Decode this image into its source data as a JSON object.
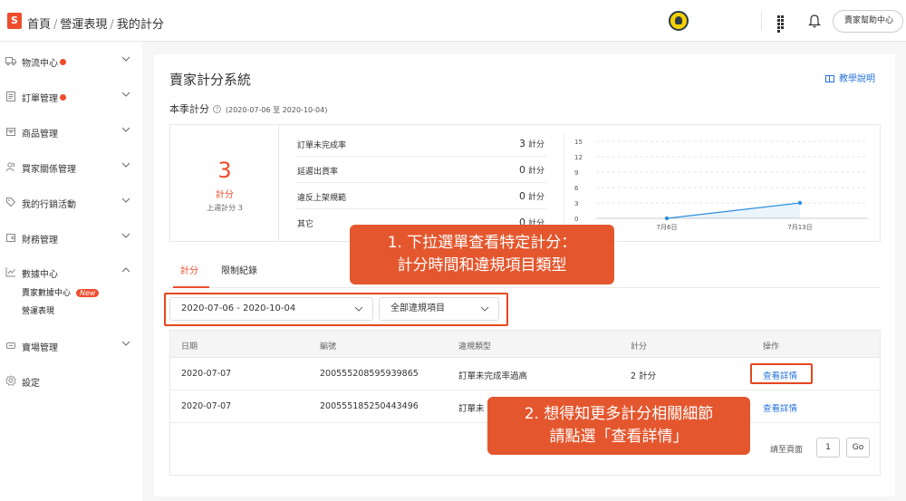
{
  "header": {
    "logo_letter": "S",
    "breadcrumb": [
      "首頁",
      "營運表現",
      "我的計分"
    ],
    "breadcrumb_sep": "/",
    "help_button": "賣家幫助中心"
  },
  "sidebar": {
    "items": [
      {
        "label": "物流中心",
        "icon": "truck-icon",
        "dot": true
      },
      {
        "label": "訂單管理",
        "icon": "clipboard-icon",
        "dot": true
      },
      {
        "label": "商品管理",
        "icon": "box-icon",
        "dot": false
      },
      {
        "label": "買家關係管理",
        "icon": "people-icon",
        "dot": false
      },
      {
        "label": "我的行銷活動",
        "icon": "tag-icon",
        "dot": false
      },
      {
        "label": "財務管理",
        "icon": "wallet-icon",
        "dot": false
      },
      {
        "label": "數據中心",
        "icon": "chart-icon",
        "dot": false,
        "expanded": true
      },
      {
        "label": "賣場管理",
        "icon": "shop-icon",
        "dot": false
      },
      {
        "label": "設定",
        "icon": "gear-icon",
        "dot": false
      }
    ],
    "subitems": [
      {
        "label": "賣家數據中心",
        "badge": "New"
      },
      {
        "label": "營運表現",
        "badge": ""
      }
    ]
  },
  "page": {
    "title": "賣家計分系統",
    "tutorial": "教學說明",
    "season_label": "本季計分",
    "season_help": "?",
    "season_range": "(2020-07-06 至 2020-10-04)"
  },
  "score": {
    "total": "3",
    "unit": "計分",
    "previous": "上週計分 3",
    "breakdown": [
      {
        "label": "訂單未完成率",
        "value": "3",
        "unit": "計分"
      },
      {
        "label": "延遲出貨率",
        "value": "0",
        "unit": "計分"
      },
      {
        "label": "違反上架規範",
        "value": "0",
        "unit": "計分"
      },
      {
        "label": "其它",
        "value": "0",
        "unit": "計分"
      }
    ]
  },
  "chart_data": {
    "type": "line",
    "x": [
      "7月6日",
      "7月13日"
    ],
    "series": [
      {
        "values": [
          0,
          3
        ]
      }
    ],
    "y_ticks": [
      "15",
      "12",
      "9",
      "6",
      "3",
      "0"
    ],
    "ylim": [
      0,
      15
    ],
    "grid": true,
    "line_color": "#2f8fde"
  },
  "tabs": [
    {
      "label": "計分",
      "active": true
    },
    {
      "label": "限制紀錄",
      "active": false
    }
  ],
  "filters": {
    "date_range": "2020-07-06 - 2020-10-04",
    "violation_type": "全部違規項目"
  },
  "table": {
    "headers": [
      "日期",
      "編號",
      "違規類型",
      "計分",
      "操作"
    ],
    "rows": [
      {
        "date": "2020-07-07",
        "id": "200555208595939865",
        "type": "訂單未完成率過高",
        "score": "2 計分",
        "action": "查看詳情"
      },
      {
        "date": "2020-07-07",
        "id": "200555185250443496",
        "type": "訂單未",
        "score": "",
        "action": "查看詳情"
      }
    ]
  },
  "pagination": {
    "jump_label": "請至頁面",
    "page": "1",
    "go": "Go"
  },
  "callouts": {
    "first": [
      "1. 下拉選單查看特定計分：",
      "計分時間和違規項目類型"
    ],
    "second": [
      "2. 想得知更多計分相關細節",
      "請點選「查看詳情」"
    ]
  },
  "colors": {
    "accent": "#ee4d2d",
    "link": "#2673dd",
    "callout": "#e4572e"
  }
}
